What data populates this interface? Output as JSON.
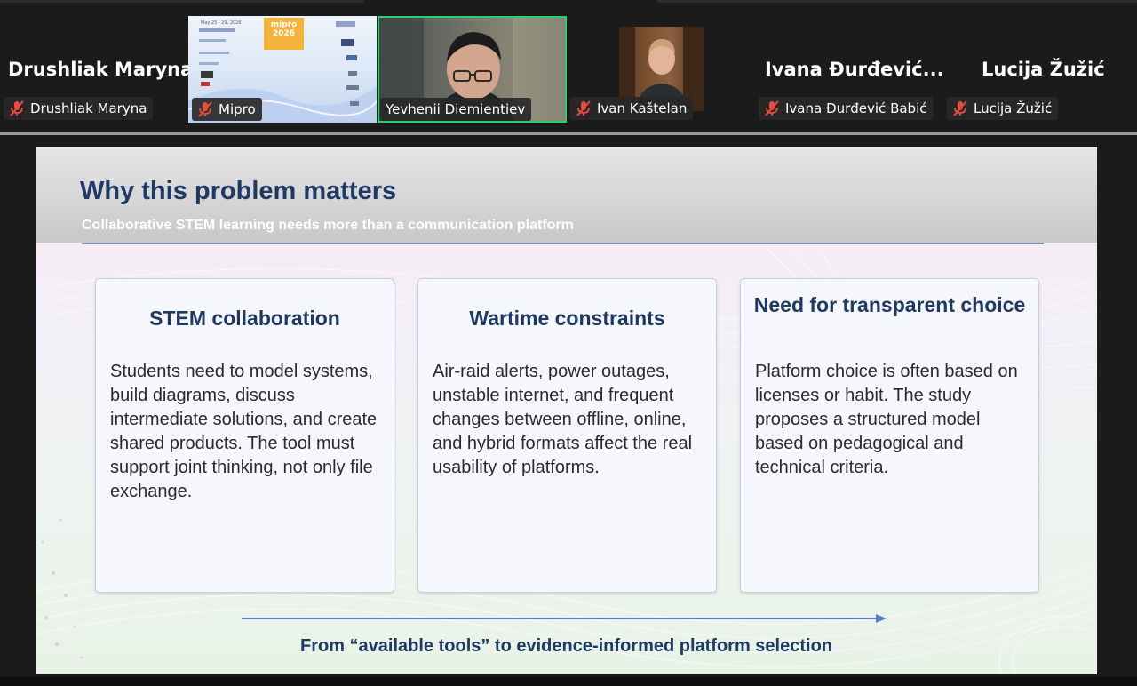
{
  "meeting": {
    "participants": [
      {
        "display_name": "Drushliak Maryna",
        "tag_label": "Drushliak Maryna",
        "muted": true,
        "mic_icon": "mic-off-icon"
      },
      {
        "tag_label": "Mipro",
        "muted": true,
        "mic_icon": "mic-off-icon",
        "video": "shared-screen-thumbnail",
        "thumb_text": {
          "dates": "May 25 - 29, 2026",
          "logo": "mipro 2026"
        }
      },
      {
        "tag_label": "Yevhenii Diemientiev",
        "muted": false,
        "video": "camera",
        "active_speaker": true
      },
      {
        "tag_label": "Ivan Kaštelan",
        "muted": true,
        "mic_icon": "mic-off-icon",
        "video": "camera"
      },
      {
        "display_name": "Ivana  Đurđević...",
        "tag_label": "Ivana Đurđević Babić",
        "muted": true,
        "mic_icon": "mic-off-icon"
      },
      {
        "display_name": "Lucija Žužić",
        "tag_label": "Lucija Žužić",
        "muted": true,
        "mic_icon": "mic-off-icon"
      }
    ],
    "colors": {
      "active_speaker_border": "#2ecc71",
      "muted_icon": "#e74c3c"
    }
  },
  "slide": {
    "title": "Why this problem matters",
    "subtitle": "Collaborative STEM learning needs more than a communication platform",
    "cards": [
      {
        "title": "STEM collaboration",
        "body": "Students need to model systems, build diagrams, discuss intermediate solutions, and create shared products. The tool must support joint thinking, not only file exchange."
      },
      {
        "title": "Wartime constraints",
        "body": "Air-raid alerts, power outages, unstable internet, and frequent changes between offline, online, and hybrid formats affect the real usability of platforms."
      },
      {
        "title": "Need for transparent choice",
        "body": "Platform choice is often based on licenses or habit. The study proposes a structured model based on pedagogical and technical criteria."
      }
    ],
    "footer": "From “available tools” to evidence-informed platform selection",
    "colors": {
      "title": "#1f3864",
      "header_band": "#c8c8c8",
      "card_bg": "#f5f7fc",
      "arrow": "#5b7bb6"
    }
  }
}
